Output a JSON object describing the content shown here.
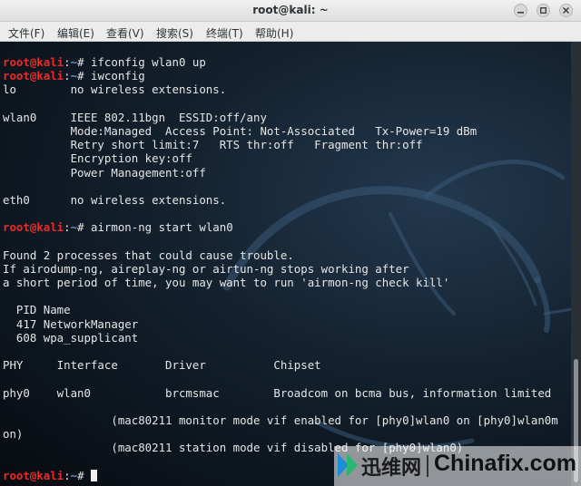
{
  "window": {
    "title": "root@kali: ~"
  },
  "menu": {
    "items": [
      "文件(F)",
      "编辑(E)",
      "查看(V)",
      "搜索(S)",
      "终端(T)",
      "帮助(H)"
    ]
  },
  "prompt": {
    "user_host": "root@kali",
    "sep": ":",
    "path": "~",
    "symbol": "# "
  },
  "terminal": {
    "lines": [
      {
        "kind": "cmd",
        "text": "ifconfig wlan0 up"
      },
      {
        "kind": "cmd",
        "text": "iwconfig"
      },
      {
        "kind": "out",
        "text": "lo        no wireless extensions."
      },
      {
        "kind": "out",
        "text": ""
      },
      {
        "kind": "out",
        "text": "wlan0     IEEE 802.11bgn  ESSID:off/any  "
      },
      {
        "kind": "out",
        "text": "          Mode:Managed  Access Point: Not-Associated   Tx-Power=19 dBm   "
      },
      {
        "kind": "out",
        "text": "          Retry short limit:7   RTS thr:off   Fragment thr:off"
      },
      {
        "kind": "out",
        "text": "          Encryption key:off"
      },
      {
        "kind": "out",
        "text": "          Power Management:off"
      },
      {
        "kind": "out",
        "text": ""
      },
      {
        "kind": "out",
        "text": "eth0      no wireless extensions."
      },
      {
        "kind": "out",
        "text": ""
      },
      {
        "kind": "cmd",
        "text": "airmon-ng start wlan0"
      },
      {
        "kind": "out",
        "text": ""
      },
      {
        "kind": "out",
        "text": "Found 2 processes that could cause trouble."
      },
      {
        "kind": "out",
        "text": "If airodump-ng, aireplay-ng or airtun-ng stops working after"
      },
      {
        "kind": "out",
        "text": "a short period of time, you may want to run 'airmon-ng check kill'"
      },
      {
        "kind": "out",
        "text": ""
      },
      {
        "kind": "out",
        "text": "  PID Name"
      },
      {
        "kind": "out",
        "text": "  417 NetworkManager"
      },
      {
        "kind": "out",
        "text": "  608 wpa_supplicant"
      },
      {
        "kind": "out",
        "text": ""
      },
      {
        "kind": "out",
        "text": "PHY     Interface       Driver          Chipset"
      },
      {
        "kind": "out",
        "text": ""
      },
      {
        "kind": "out",
        "text": "phy0    wlan0           brcmsmac        Broadcom on bcma bus, information limited"
      },
      {
        "kind": "out",
        "text": ""
      },
      {
        "kind": "out",
        "text": "                (mac80211 monitor mode vif enabled for [phy0]wlan0 on [phy0]wlan0m"
      },
      {
        "kind": "out",
        "text": "on)"
      },
      {
        "kind": "out",
        "text": "                (mac80211 station mode vif disabled for [phy0]wlan0)"
      },
      {
        "kind": "out",
        "text": ""
      },
      {
        "kind": "cmd",
        "text": "",
        "cursor": true
      }
    ]
  },
  "watermark": {
    "cn_text": "迅维网",
    "en_text": "Chinafix.com"
  },
  "icons": {
    "minimize": "minimize-icon",
    "maximize": "maximize-icon",
    "close": "close-icon",
    "dragon": "kali-dragon-icon",
    "watermark_logo": "chinafix-logo-icon"
  }
}
